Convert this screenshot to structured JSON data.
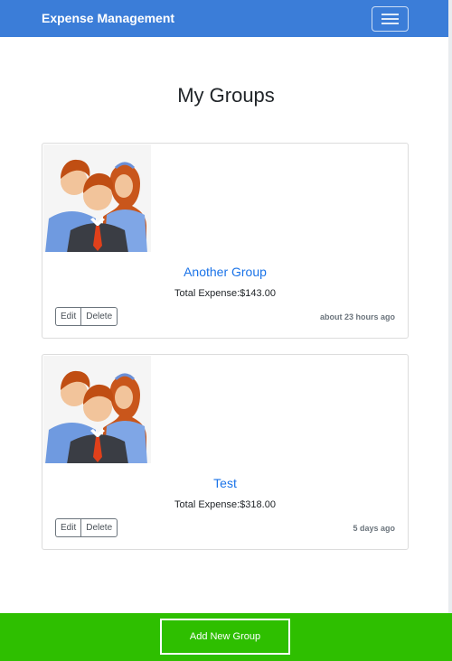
{
  "navbar": {
    "brand": "Expense Management",
    "toggler_icon": "hamburger-icon"
  },
  "page": {
    "title": "My Groups"
  },
  "groups": [
    {
      "name": "Another Group",
      "total": "Total Expense:$143.00",
      "edit_label": "Edit",
      "delete_label": "Delete",
      "updated": "about 23 hours ago",
      "image_icon": "group-avatar-icon"
    },
    {
      "name": "Test",
      "total": "Total Expense:$318.00",
      "edit_label": "Edit",
      "delete_label": "Delete",
      "updated": "5 days ago",
      "image_icon": "group-avatar-icon"
    }
  ],
  "footer": {
    "add_label": "Add New Group"
  },
  "colors": {
    "navbar": "#3b7dd8",
    "link": "#1a73e8",
    "footer": "#2ebf00"
  }
}
